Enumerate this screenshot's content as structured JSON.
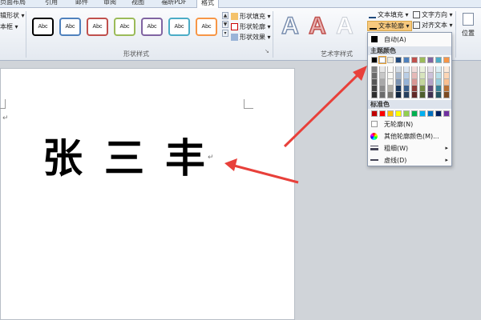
{
  "tabs": [
    {
      "label": "页面布局"
    },
    {
      "label": "引用"
    },
    {
      "label": "邮件"
    },
    {
      "label": "审阅"
    },
    {
      "label": "视图"
    },
    {
      "label": "福昕PDF"
    },
    {
      "label": "格式"
    }
  ],
  "ribbon": {
    "left_items": [
      "辑形状 ▾",
      "本框 ▾"
    ],
    "shape_style_sample": "Abc",
    "shape_styles_colors": [
      "#000000",
      "#4f81bd",
      "#c0504d",
      "#9bbb59",
      "#8064a2",
      "#4bacc6",
      "#f79646"
    ],
    "shape_fill": "形状填充 ▾",
    "shape_outline": "形状轮廓 ▾",
    "shape_effects": "形状效果 ▾",
    "group_shape_styles": "形状样式",
    "wordart_letter": "A",
    "text_fill": "文本填充 ▾",
    "text_outline": "文本轮廓 ▾",
    "text_direction": "文字方向 ▾",
    "align_text": "对齐文本 ▾",
    "group_wordart": "艺术字样式",
    "position": "位置"
  },
  "document": {
    "name_chars": [
      "张",
      "三",
      "丰"
    ],
    "para_mark": "↵"
  },
  "dropdown": {
    "auto": "自动(A)",
    "theme_colors_header": "主题颜色",
    "theme_top": [
      "#000000",
      "#ffffff",
      "#eeece1",
      "#1f497d",
      "#4f81bd",
      "#c0504d",
      "#9bbb59",
      "#8064a2",
      "#4bacc6",
      "#f79646"
    ],
    "standard_header": "标准色",
    "standard_colors": [
      "#c00000",
      "#ff0000",
      "#ffc000",
      "#ffff00",
      "#92d050",
      "#00b050",
      "#00b0f0",
      "#0070c0",
      "#002060",
      "#7030a0"
    ],
    "no_outline": "无轮廓(N)",
    "more_colors": "其他轮廓颜色(M)...",
    "weight": "粗细(W)",
    "dashes": "虚线(D)"
  },
  "colors": {
    "annotation_arrow": "#e8403a",
    "ribbon_bg": "#e4e9f0",
    "highlight": "#f7c97e"
  }
}
